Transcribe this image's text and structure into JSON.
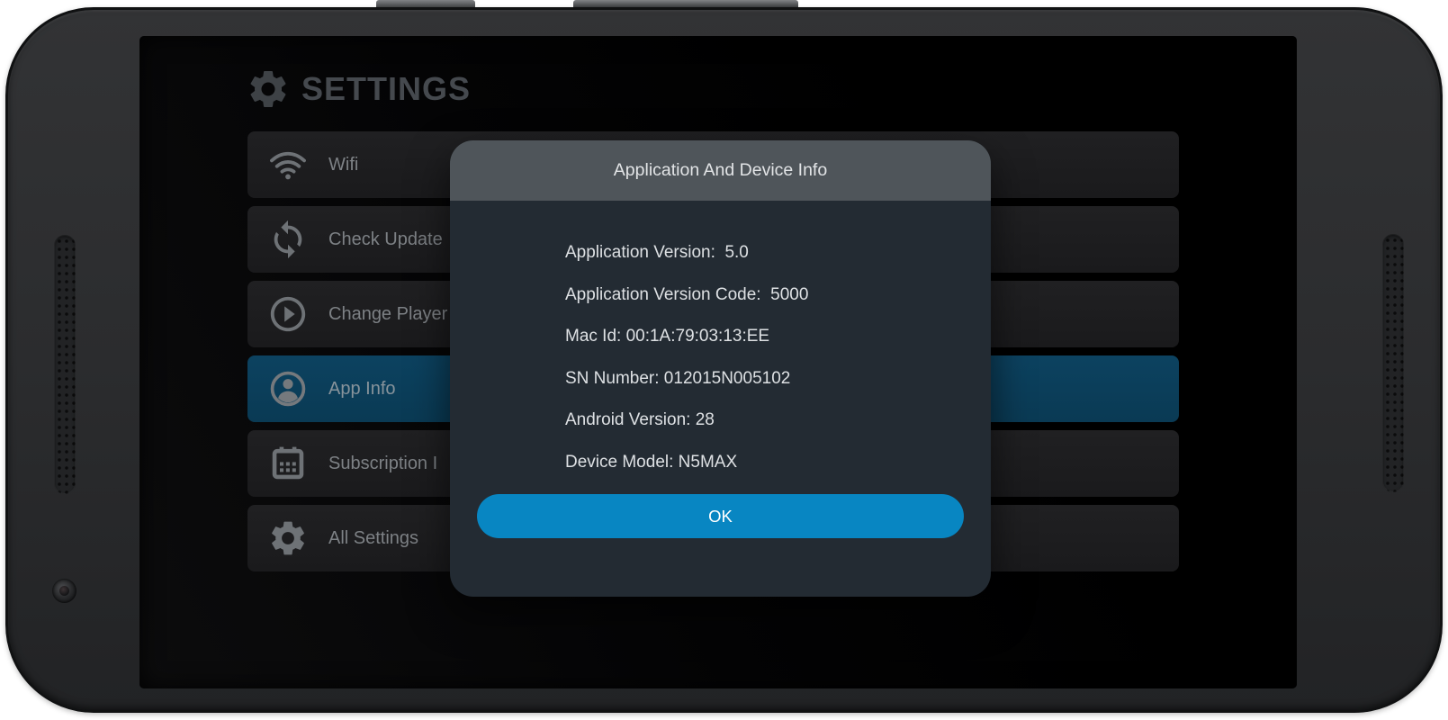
{
  "colors": {
    "accent_blue": "#0886c2",
    "highlight_row_bg": "#0b3f5a",
    "dialog_header_bg": "#4f555a",
    "dialog_body_bg": "#232b33",
    "row_bg": "#1d1d1e",
    "screen_bg": "#050505",
    "row_text": "#7d8185",
    "settings_title_text": "#45494e"
  },
  "header": {
    "title": "SETTINGS",
    "icon": "gear-icon"
  },
  "menu": {
    "items": [
      {
        "label": "Wifi",
        "icon": "wifi-icon",
        "active": false
      },
      {
        "label": "Check Update",
        "icon": "sync-icon",
        "active": false
      },
      {
        "label": "Change Player",
        "icon": "play-circle-icon",
        "active": false
      },
      {
        "label": "App Info",
        "icon": "account-circle-icon",
        "active": true
      },
      {
        "label": "Subscription I",
        "icon": "calendar-icon",
        "active": false
      },
      {
        "label": "All Settings",
        "icon": "gear-icon",
        "active": false
      }
    ]
  },
  "dialog": {
    "title": "Application And Device Info",
    "info_lines": [
      "Application Version:  5.0",
      "Application Version Code:  5000",
      "Mac Id: 00:1A:79:03:13:EE",
      "SN Number: 012015N005102",
      "Android Version: 28",
      "Device Model: N5MAX"
    ],
    "ok_label": "OK"
  },
  "hardware": {
    "buttons": [
      "power-button",
      "volume-rocker"
    ],
    "features": [
      "left-speaker-grille",
      "right-speaker-grille",
      "front-camera"
    ]
  }
}
